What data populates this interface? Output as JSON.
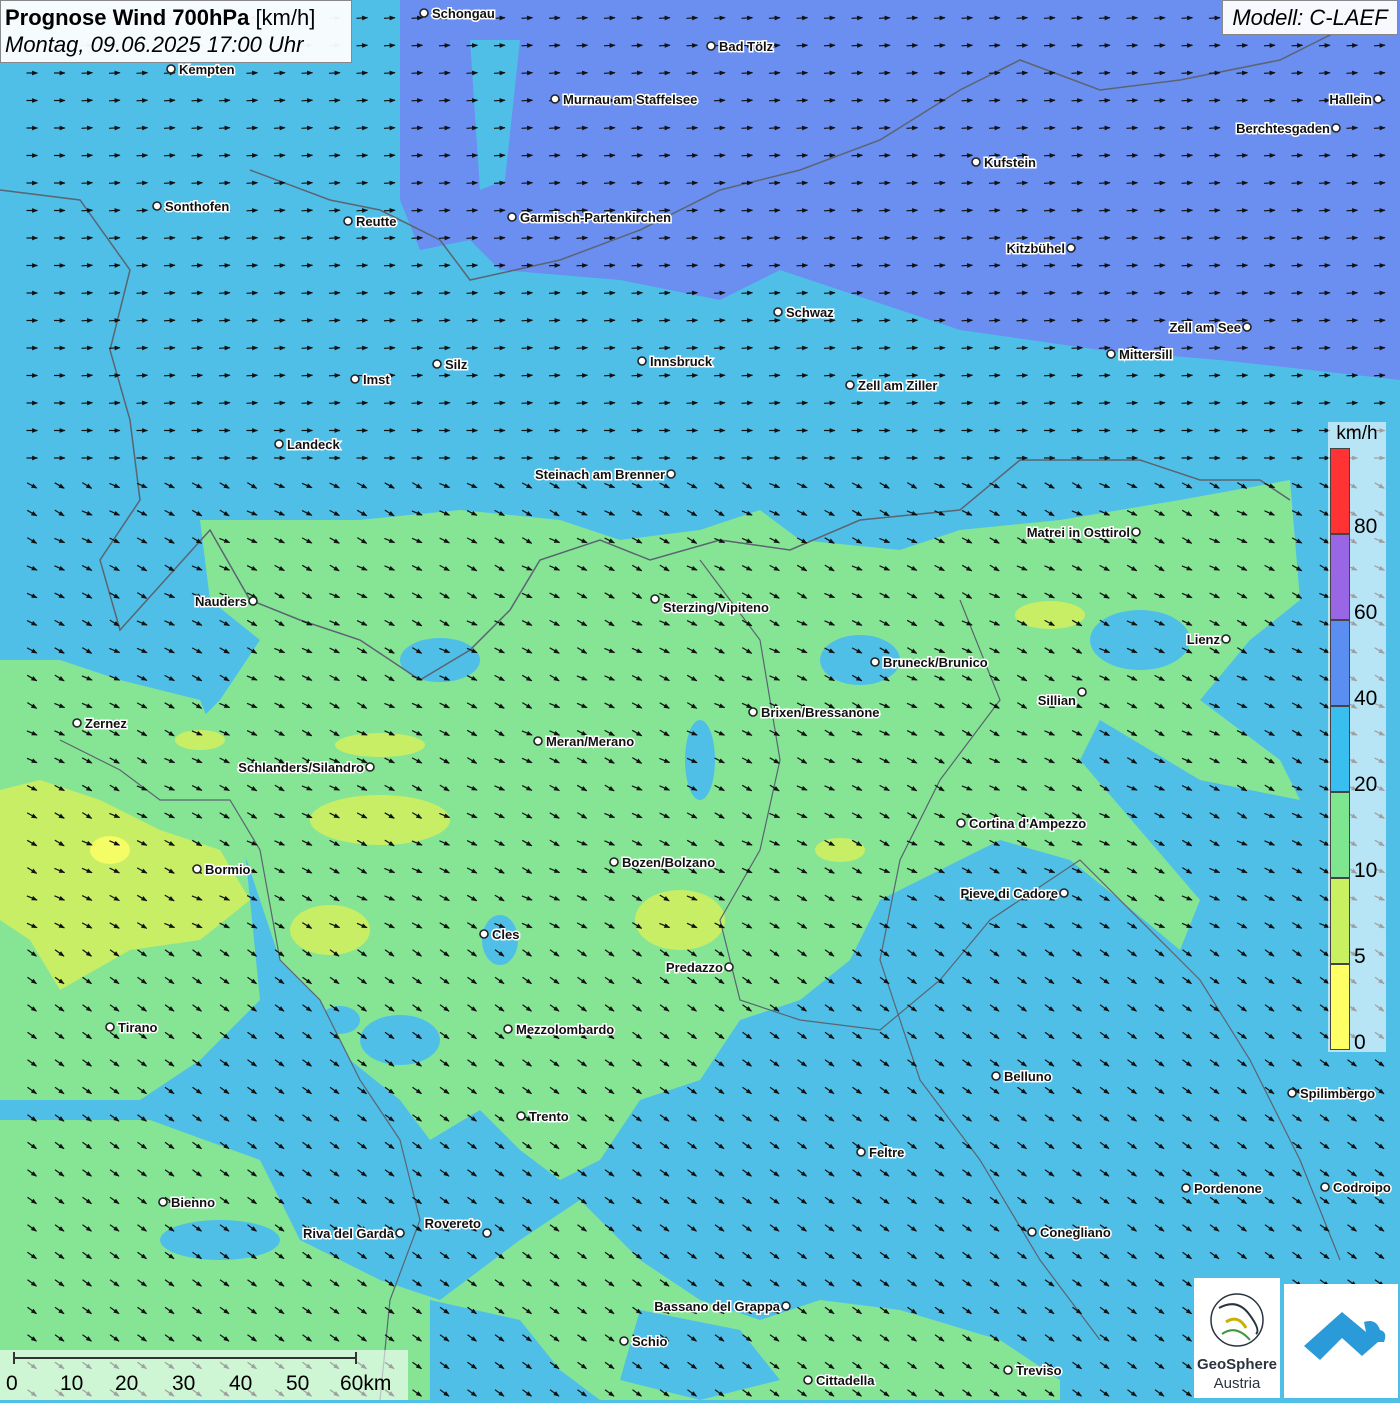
{
  "header": {
    "title_bold": "Prognose Wind 700hPa",
    "title_unit": "[km/h]",
    "datetime": "Montag, 09.06.2025 17:00 Uhr",
    "model": "Modell: C-LAEF"
  },
  "legend": {
    "unit": "km/h",
    "classes": [
      {
        "label": "0",
        "color": "#ffff66"
      },
      {
        "label": "5",
        "color": "#c8f060"
      },
      {
        "label": "10",
        "color": "#7fe690"
      },
      {
        "label": "20",
        "color": "#38bff0"
      },
      {
        "label": "40",
        "color": "#5a8ef0"
      },
      {
        "label": "60",
        "color": "#9966e6"
      },
      {
        "label": "80",
        "color": "#ff3333"
      }
    ]
  },
  "scale": {
    "labels": [
      "0",
      "10",
      "20",
      "30",
      "40",
      "50",
      "60km"
    ]
  },
  "cities": [
    {
      "name": "Schongau"
    },
    {
      "name": "Bad Tölz"
    },
    {
      "name": "Kempten"
    },
    {
      "name": "Murnau am Staffelsee"
    },
    {
      "name": "Hallein"
    },
    {
      "name": "Berchtesgaden"
    },
    {
      "name": "Kufstein"
    },
    {
      "name": "Sonthofen"
    },
    {
      "name": "Reutte"
    },
    {
      "name": "Garmisch-Partenkirchen"
    },
    {
      "name": "Kitzbühel"
    },
    {
      "name": "Schwaz"
    },
    {
      "name": "Zell am See"
    },
    {
      "name": "Mittersill"
    },
    {
      "name": "Innsbruck"
    },
    {
      "name": "Silz"
    },
    {
      "name": "Imst"
    },
    {
      "name": "Zell am Ziller"
    },
    {
      "name": "Landeck"
    },
    {
      "name": "Steinach am Brenner"
    },
    {
      "name": "Matrei in Osttirol"
    },
    {
      "name": "Nauders"
    },
    {
      "name": "Sterzing/Vipiteno"
    },
    {
      "name": "Lienz"
    },
    {
      "name": "Bruneck/Brunico"
    },
    {
      "name": "Sillian"
    },
    {
      "name": "Zernez"
    },
    {
      "name": "Brixen/Bressanone"
    },
    {
      "name": "Meran/Merano"
    },
    {
      "name": "Schlanders/Silandro"
    },
    {
      "name": "Cortina d'Ampezzo"
    },
    {
      "name": "Bozen/Bolzano"
    },
    {
      "name": "Bormio"
    },
    {
      "name": "Pieve di Cadore"
    },
    {
      "name": "Cles"
    },
    {
      "name": "Predazzo"
    },
    {
      "name": "Tirano"
    },
    {
      "name": "Mezzolombardo"
    },
    {
      "name": "Belluno"
    },
    {
      "name": "Spilimbergo"
    },
    {
      "name": "Trento"
    },
    {
      "name": "Feltre"
    },
    {
      "name": "Bienno"
    },
    {
      "name": "Pordenone"
    },
    {
      "name": "Codroipo"
    },
    {
      "name": "Riva del Garda"
    },
    {
      "name": "Rovereto"
    },
    {
      "name": "Conegliano"
    },
    {
      "name": "Bassano del Grappa"
    },
    {
      "name": "Schio"
    },
    {
      "name": "Treviso"
    },
    {
      "name": "Cittadella"
    }
  ],
  "logos": {
    "geosphere_line1": "GeoSphere",
    "geosphere_line2": "Austria"
  }
}
